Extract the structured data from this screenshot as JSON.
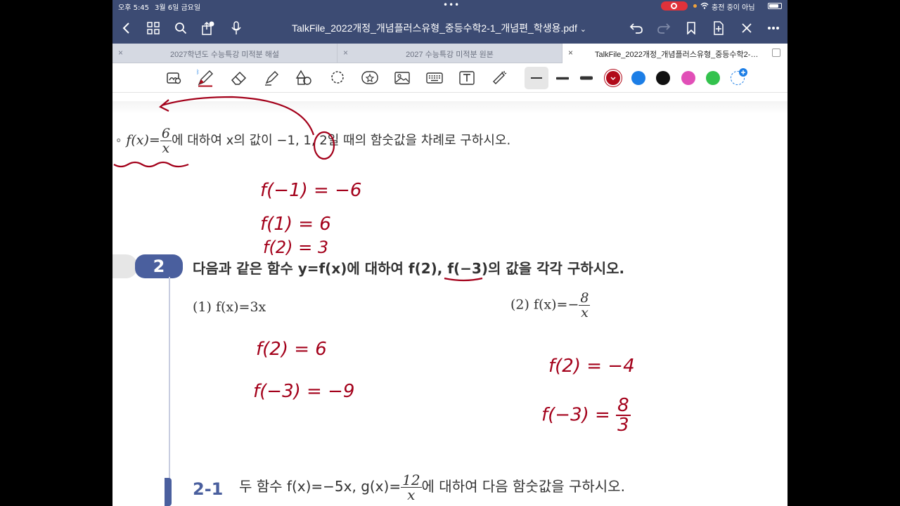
{
  "status": {
    "time": "오후 5:45",
    "date": "3월 6일 금요일",
    "charging": "충전 중이 아님"
  },
  "header": {
    "title": "TalkFile_2022개정_개념플러스유형_중등수학2-1_개념편_학생용.pdf",
    "title_chevron": "⌄"
  },
  "tabs": [
    {
      "label": "2027학년도 수능특강 미적분 해설",
      "close": "×"
    },
    {
      "label": "2027 수능특강 미적분 원본",
      "close": "×"
    },
    {
      "label": "TalkFile_2022개정_개념플러스유형_중등수학2-…",
      "close": "×",
      "active": true
    }
  ],
  "toolbar": {
    "tools": [
      "lasso-select-icon",
      "pen-icon",
      "eraser-icon",
      "highlighter-icon",
      "shapes-icon",
      "lasso-icon",
      "sticker-icon",
      "image-icon",
      "keyboard-icon",
      "text-box-icon",
      "laser-pointer-icon"
    ],
    "colors": [
      "#b10a1a",
      "#1c7ee6",
      "#111111",
      "#e14fb7",
      "#33c24d"
    ],
    "selected_color": "#b10a1a"
  },
  "page": {
    "problem1": {
      "lead": "f(x)=",
      "frac_num": "6",
      "frac_den": "x",
      "rest": "에 대하여 x의 값이 −1, 1, 2일 때의 함숫값을 차례로 구하시오."
    },
    "problem2": {
      "number": "2",
      "text": "다음과 같은 함수 y=f(x)에 대하여 f(2), f(−3)의 값을 각각 구하시오.",
      "part1": "(1) f(x)=3x",
      "part2_lead": "(2) f(x)=−",
      "part2_num": "8",
      "part2_den": "x"
    },
    "problem2_1": {
      "number": "2-1",
      "lead": "두 함수 f(x)=−5x, g(x)=",
      "frac_num": "12",
      "frac_den": "x",
      "rest": "에 대하여 다음 함숫값을 구하시오."
    },
    "handwriting": {
      "a1": "f(−1) = −6",
      "a2": "f(1) = 6",
      "a3": "f(2) = 3",
      "b1": "f(2) = 6",
      "b2": "f(−3) = −9",
      "c1": "f(2) = −4",
      "c2_lead": "f(−3) =",
      "c2_num": "8",
      "c2_den": "3"
    }
  }
}
